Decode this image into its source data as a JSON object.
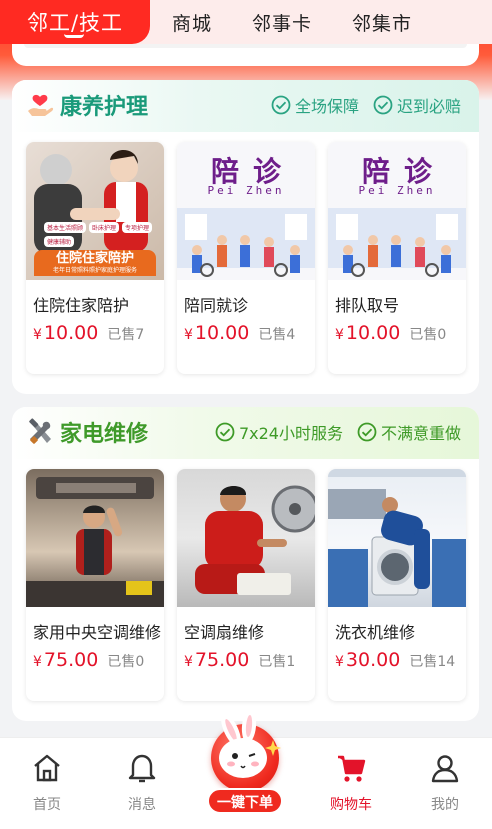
{
  "top_tabs": {
    "active": "邻工/技工",
    "items": [
      "商城",
      "邻事卡",
      "邻集市"
    ]
  },
  "sections": {
    "care": {
      "title": "康养护理",
      "tags": [
        "全场保障",
        "迟到必赔"
      ],
      "items": [
        {
          "name": "住院住家陪护",
          "price": "10.00",
          "sold": "已售7",
          "banner": "住院住家陪护",
          "banner_sub": "老年日常照料照护家庭护理服务",
          "badges": [
            "基本生活照顾",
            "专项护理",
            "卧床护理",
            "健康辅助"
          ]
        },
        {
          "name": "陪同就诊",
          "price": "10.00",
          "sold": "已售4",
          "pz_title": "陪诊",
          "pz_sub": "Pei Zhen"
        },
        {
          "name": "排队取号",
          "price": "10.00",
          "sold": "已售0",
          "pz_title": "陪诊",
          "pz_sub": "Pei Zhen"
        }
      ]
    },
    "repair": {
      "title": "家电维修",
      "tags": [
        "7x24小时服务",
        "不满意重做"
      ],
      "items": [
        {
          "name": "家用中央空调维修",
          "price": "75.00",
          "sold": "已售0"
        },
        {
          "name": "空调扇维修",
          "price": "75.00",
          "sold": "已售1"
        },
        {
          "name": "洗衣机维修",
          "price": "30.00",
          "sold": "已售14"
        }
      ]
    }
  },
  "currency": "¥",
  "bottom_nav": {
    "items": [
      {
        "label": "首页",
        "icon": "home-icon"
      },
      {
        "label": "消息",
        "icon": "bell-icon"
      },
      {
        "label": "购物车",
        "icon": "cart-icon",
        "active": true
      },
      {
        "label": "我的",
        "icon": "user-icon"
      }
    ],
    "center_label": "一键下单"
  },
  "colors": {
    "brand_red": "#ff2a22",
    "price_red": "#e3132a",
    "care_green": "#1a9a7a",
    "repair_green": "#3f9a2a"
  }
}
